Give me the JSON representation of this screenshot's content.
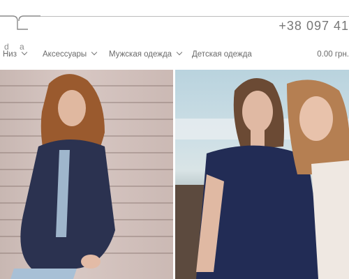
{
  "header": {
    "logo_sub": "d  a",
    "phone": "+38 097 41"
  },
  "nav": {
    "items": [
      {
        "label": "Низ"
      },
      {
        "label": "Аксессуары"
      },
      {
        "label": "Мужская одежда"
      },
      {
        "label": "Детская одежда"
      }
    ],
    "cart": "0.00 грн."
  },
  "colors": {
    "text": "#6f6f6f",
    "rule": "#bdbdbd",
    "denim": "#2b3250"
  }
}
